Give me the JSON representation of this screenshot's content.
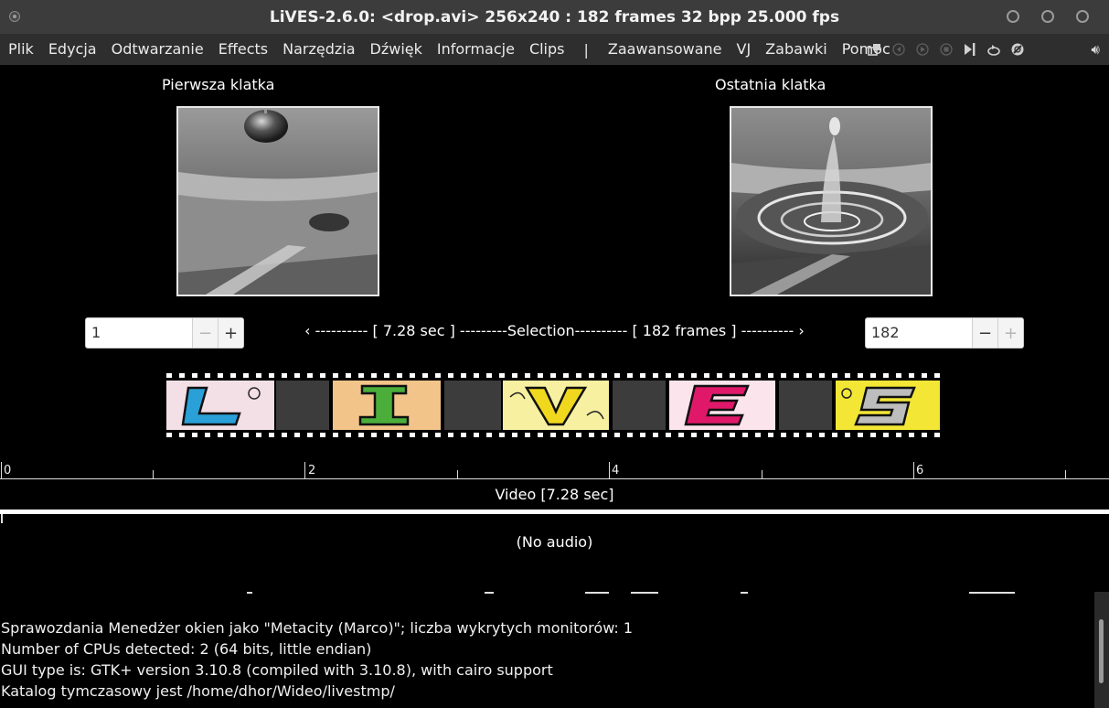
{
  "window": {
    "title": "LiVES-2.6.0: <drop.avi> 256x240 : 182 frames 32 bpp 25.000 fps"
  },
  "menu": {
    "items": [
      "Plik",
      "Edycja",
      "Odtwarzanie",
      "Effects",
      "Narzędzia",
      "Dźwięk",
      "Informacje",
      "Clips"
    ],
    "separator": "|",
    "items_right": [
      "Zaawansowane",
      "VJ",
      "Zabawki",
      "Pomoc"
    ]
  },
  "toolbar": {
    "icons": [
      "sepwin-icon",
      "rewind-icon",
      "play-icon",
      "stop-icon",
      "play-selection-icon",
      "loop-icon",
      "mute-icon"
    ],
    "volume_icon": "volume-icon"
  },
  "frames": {
    "first_label": "Pierwsza klatka",
    "last_label": "Ostatnia klatka"
  },
  "start_spin": {
    "value": "1",
    "minus": "−",
    "plus": "+"
  },
  "end_spin": {
    "value": "182",
    "minus": "−",
    "plus": "+"
  },
  "selection": {
    "left_arrow": "‹",
    "text": "---------- [ 7.28 sec ] ---------Selection---------- [ 182 frames ] ----------",
    "right_arrow": "›"
  },
  "timeline": {
    "ticks": [
      "0",
      "2",
      "4",
      "6"
    ],
    "video_label": "Video [7.28 sec]",
    "audio_label": "(No audio)"
  },
  "log": {
    "lines": [
      "Sprawozdania Menedżer okien jako \"Metacity (Marco)\"; liczba wykrytych monitorów: 1",
      "Number of CPUs detected: 2 (64 bits, little endian)",
      "GUI type is: GTK+ version 3.10.8 (compiled with 3.10.8), with cairo support",
      "Katalog tymczasowy jest /home/dhor/Wideo/livestmp/"
    ]
  }
}
